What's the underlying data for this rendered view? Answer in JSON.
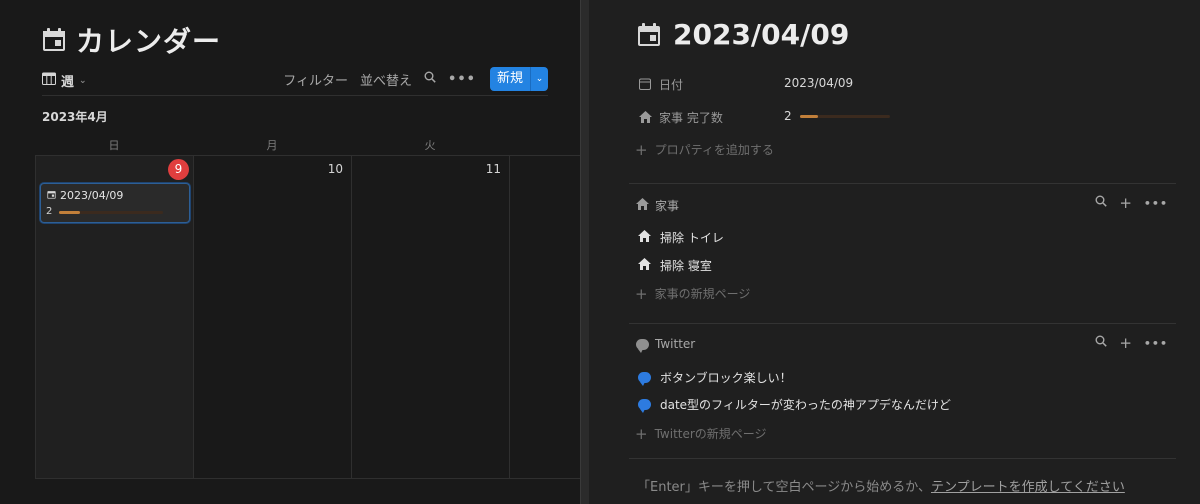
{
  "calendar": {
    "title": "カレンダー",
    "view_label": "週",
    "toolbar": {
      "filter_label": "フィルター",
      "sort_label": "並べ替え",
      "more_label": "•••",
      "new_label": "新規"
    },
    "month_label": "2023年4月",
    "weekdays": [
      "日",
      "月",
      "火"
    ],
    "days": [
      {
        "num": "9",
        "today": true
      },
      {
        "num": "10",
        "today": false
      },
      {
        "num": "11",
        "today": false
      }
    ],
    "event": {
      "title": "2023/04/09",
      "value": "2",
      "progress": 0.2
    }
  },
  "page": {
    "title": "2023/04/09",
    "properties": [
      {
        "icon": "calendar-icon",
        "label": "日付",
        "value": "2023/04/09"
      },
      {
        "icon": "house-icon",
        "label": "家事 完了数",
        "value": "2",
        "progress": 0.2
      }
    ],
    "add_property_label": "プロパティを追加する",
    "sections": [
      {
        "icon": "house-icon",
        "title": "家事",
        "items": [
          "掃除 トイレ",
          "掃除 寝室"
        ],
        "new_page_label": "家事の新規ページ"
      },
      {
        "icon": "speech-bubble-icon",
        "title": "Twitter",
        "items": [
          "ボタンブロック楽しい！",
          "date型のフィルターが変わったの神アプデなんだけど"
        ],
        "new_page_label": "Twitterの新規ページ"
      }
    ],
    "footer_hint_prefix": "「Enter」キーを押して空白ページから始めるか、",
    "footer_hint_link": "テンプレートを作成してください"
  },
  "colors": {
    "accent": "#2383e2",
    "today_badge": "#e03e3e",
    "progress_fill": "#c17f3a",
    "bubble": "#2d7be0"
  }
}
